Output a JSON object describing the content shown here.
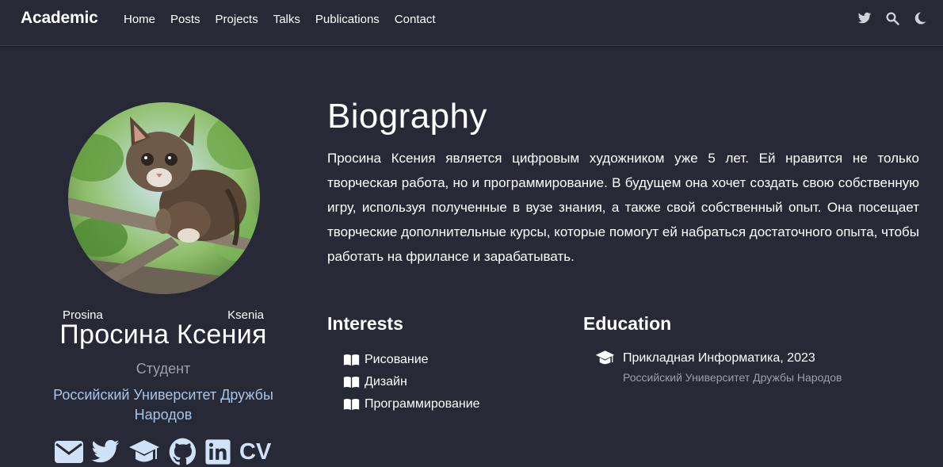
{
  "navbar": {
    "brand": "Academic",
    "links": [
      "Home",
      "Posts",
      "Projects",
      "Talks",
      "Publications",
      "Contact"
    ],
    "right_icons": [
      "twitter-icon",
      "search-icon",
      "moon-icon"
    ]
  },
  "profile": {
    "avatar_alt": "kitten-on-branch",
    "first_name": "Prosina",
    "last_name": "Ksenia",
    "display_name": "Просина Ксения",
    "role": "Студент",
    "organization": "Российский Университет Дружбы Народов",
    "social_icons": [
      "envelope-icon",
      "twitter-icon",
      "graduation-cap-icon",
      "github-icon",
      "linkedin-icon"
    ],
    "cv_label": "CV"
  },
  "biography": {
    "title": "Biography",
    "text": "Просина Ксения является цифровым художником уже 5 лет. Ей нравится не только творческая работа, но и программирование. В будущем она хочет создать свою собственную игру, используя полученные в вузе знания, а также свой собственный опыт. Она посещает творческие дополнительные курсы, которые помогут ей набраться достаточного опыта, чтобы работать на фрилансе и зарабатывать."
  },
  "interests": {
    "title": "Interests",
    "items": [
      "Рисование",
      "Дизайн",
      "Программирование"
    ]
  },
  "education": {
    "title": "Education",
    "course": "Прикладная Информатика, 2023",
    "institution": "Российский Университет Дружбы Народов"
  },
  "colors": {
    "background": "#272a36",
    "text": "#ffffff",
    "muted": "#9aa0ac",
    "link": "#a7c4e8"
  }
}
